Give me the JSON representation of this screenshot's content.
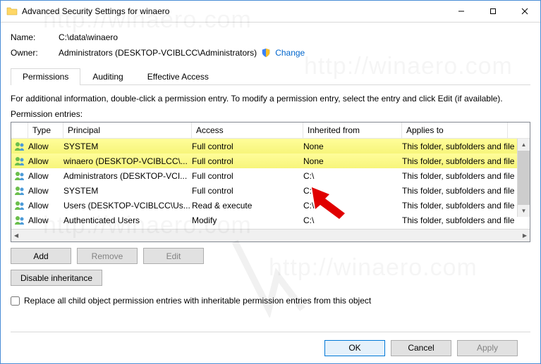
{
  "window": {
    "title": "Advanced Security Settings for winaero"
  },
  "props": {
    "name_label": "Name:",
    "name_value": "C:\\data\\winaero",
    "owner_label": "Owner:",
    "owner_value": "Administrators (DESKTOP-VCIBLCC\\Administrators)",
    "change_link": "Change"
  },
  "tabs": {
    "permissions": "Permissions",
    "auditing": "Auditing",
    "effective": "Effective Access"
  },
  "info": "For additional information, double-click a permission entry. To modify a permission entry, select the entry and click Edit (if available).",
  "entries_label": "Permission entries:",
  "grid": {
    "headers": {
      "type": "Type",
      "principal": "Principal",
      "access": "Access",
      "inherited": "Inherited from",
      "applies": "Applies to"
    },
    "rows": [
      {
        "hl": true,
        "type": "Allow",
        "principal": "SYSTEM",
        "access": "Full control",
        "inherited": "None",
        "applies": "This folder, subfolders and file"
      },
      {
        "hl": true,
        "type": "Allow",
        "principal": "winaero (DESKTOP-VCIBLCC\\...",
        "access": "Full control",
        "inherited": "None",
        "applies": "This folder, subfolders and file"
      },
      {
        "hl": false,
        "type": "Allow",
        "principal": "Administrators (DESKTOP-VCI...",
        "access": "Full control",
        "inherited": "C:\\",
        "applies": "This folder, subfolders and file"
      },
      {
        "hl": false,
        "type": "Allow",
        "principal": "SYSTEM",
        "access": "Full control",
        "inherited": "C:\\",
        "applies": "This folder, subfolders and file"
      },
      {
        "hl": false,
        "type": "Allow",
        "principal": "Users (DESKTOP-VCIBLCC\\Us...",
        "access": "Read & execute",
        "inherited": "C:\\",
        "applies": "This folder, subfolders and file"
      },
      {
        "hl": false,
        "type": "Allow",
        "principal": "Authenticated Users",
        "access": "Modify",
        "inherited": "C:\\",
        "applies": "This folder, subfolders and file"
      }
    ]
  },
  "buttons": {
    "add": "Add",
    "remove": "Remove",
    "edit": "Edit",
    "disable_inh": "Disable inheritance",
    "replace_label": "Replace all child object permission entries with inheritable permission entries from this object"
  },
  "footer": {
    "ok": "OK",
    "cancel": "Cancel",
    "apply": "Apply"
  },
  "watermark": "http://winaero.com"
}
